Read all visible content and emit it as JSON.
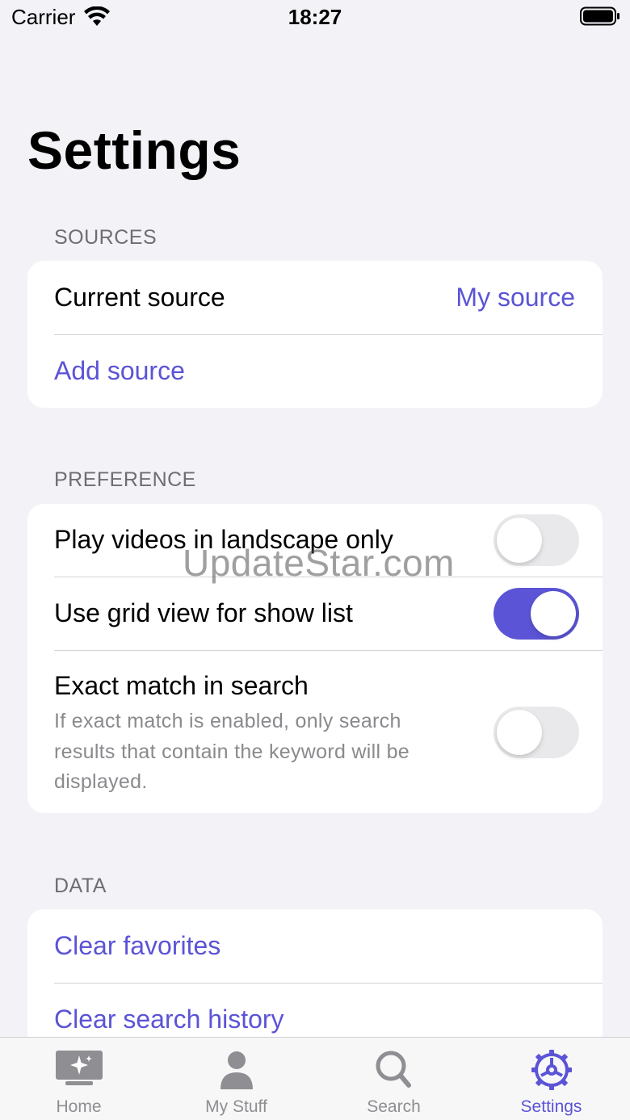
{
  "status_bar": {
    "carrier": "Carrier",
    "time": "18:27"
  },
  "page": {
    "title": "Settings"
  },
  "sections": {
    "sources": {
      "header": "SOURCES",
      "current_source_label": "Current source",
      "current_source_value": "My source",
      "add_source_label": "Add source"
    },
    "preference": {
      "header": "PREFERENCE",
      "landscape_label": "Play videos in landscape only",
      "landscape_on": false,
      "grid_label": "Use grid view for show list",
      "grid_on": true,
      "exact_label": "Exact match in search",
      "exact_sub_line1": "If exact match is enabled, only search",
      "exact_sub_line2": "results that contain the keyword will be",
      "exact_sub_line3": "displayed.",
      "exact_on": false
    },
    "data": {
      "header": "DATA",
      "clear_favorites_label": "Clear favorites",
      "clear_history_label": "Clear search history"
    }
  },
  "watermark": "UpdateStar.com",
  "tab_bar": {
    "tabs": [
      {
        "label": "Home",
        "icon": "home-sparkle-icon",
        "active": false
      },
      {
        "label": "My Stuff",
        "icon": "person-icon",
        "active": false
      },
      {
        "label": "Search",
        "icon": "search-icon",
        "active": false
      },
      {
        "label": "Settings",
        "icon": "gear-icon",
        "active": true
      }
    ]
  },
  "colors": {
    "accent": "#5b54d6",
    "background": "#f2f2f7",
    "secondary_text": "#8a8a8e",
    "inactive_tab": "#8e8e93"
  }
}
